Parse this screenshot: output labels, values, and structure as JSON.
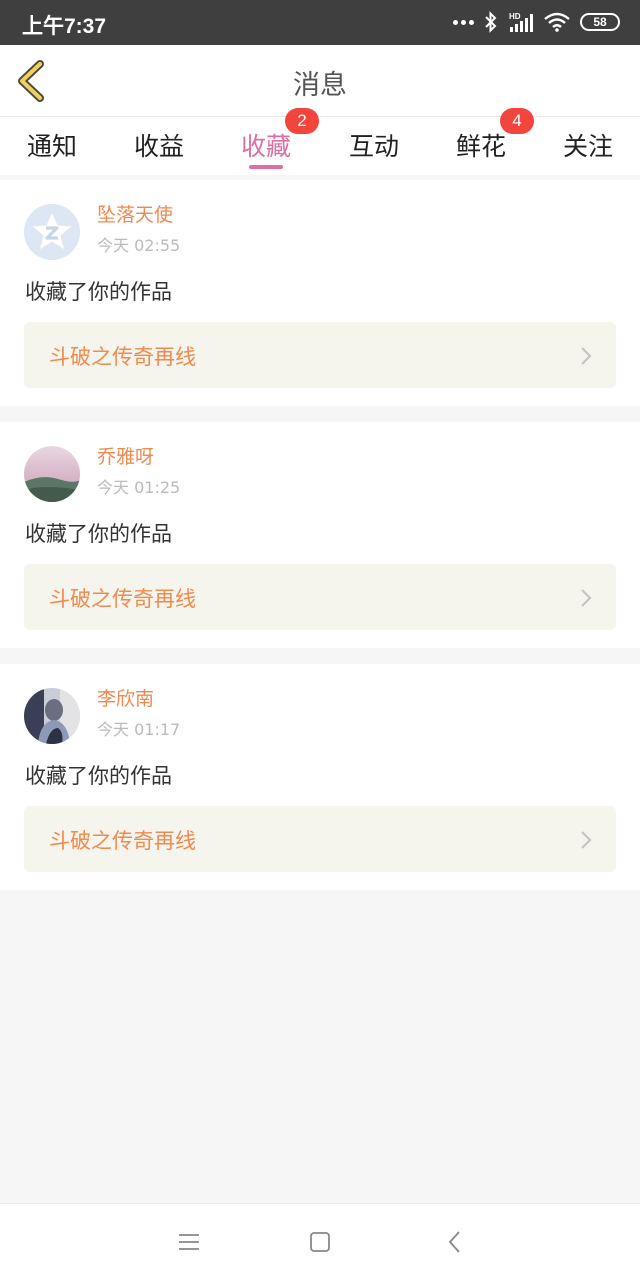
{
  "status_bar": {
    "time": "上午7:37",
    "battery": "58",
    "icons": [
      "more-dots-icon",
      "bluetooth-icon",
      "hd-signal-icon",
      "wifi-icon",
      "battery-icon"
    ]
  },
  "header": {
    "title": "消息",
    "back_icon": "chevron-left-icon"
  },
  "tabs": [
    {
      "label": "通知"
    },
    {
      "label": "收益"
    },
    {
      "label": "收藏",
      "badge": "2",
      "active": true
    },
    {
      "label": "互动"
    },
    {
      "label": "鲜花",
      "badge": "4"
    },
    {
      "label": "关注"
    }
  ],
  "messages": [
    {
      "user": "坠落天使",
      "time": "今天 02:55",
      "action": "收藏了你的作品",
      "work": "斗破之传奇再线"
    },
    {
      "user": "乔雅呀",
      "time": "今天 01:25",
      "action": "收藏了你的作品",
      "work": "斗破之传奇再线"
    },
    {
      "user": "李欣南",
      "time": "今天 01:17",
      "action": "收藏了你的作品",
      "work": "斗破之传奇再线"
    }
  ],
  "nav": {
    "icons": [
      "menu-icon",
      "home-square-icon",
      "back-triangle-icon"
    ]
  },
  "colors": {
    "accent_pink": "#e06ea3",
    "name_orange": "#f0894f",
    "badge_red": "#f2453d",
    "link_bg": "#f5f5ee"
  }
}
